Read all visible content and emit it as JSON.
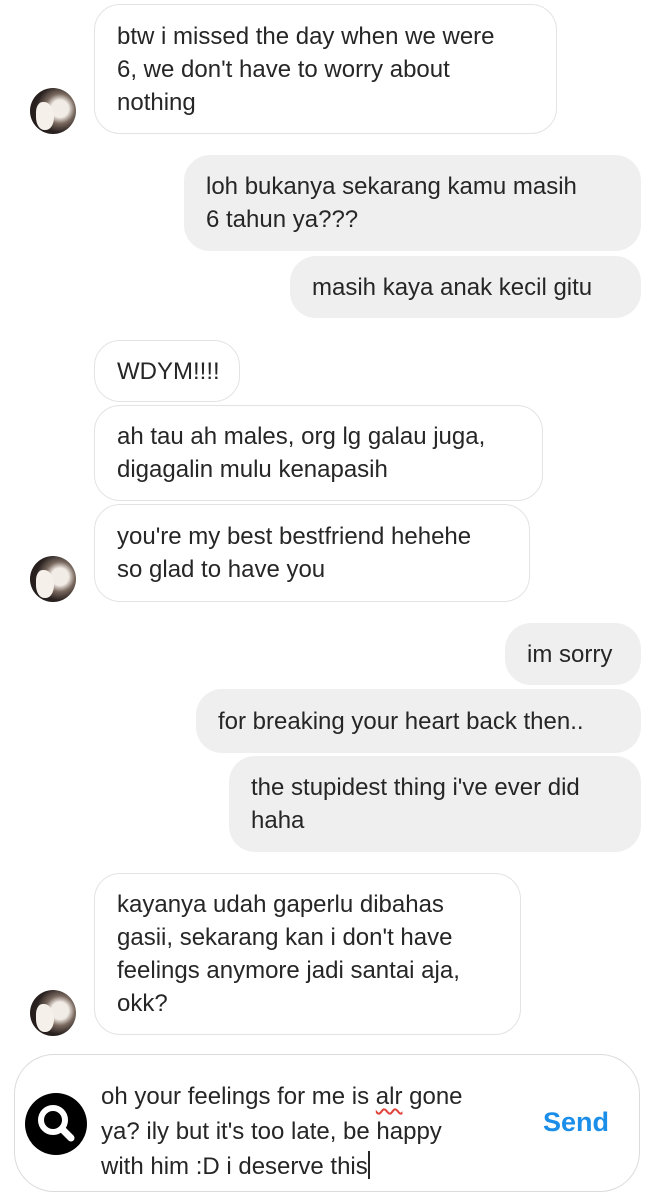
{
  "messages": [
    {
      "side": "in",
      "text": "btw i missed the day when we were\n6, we don't have to worry about\nnothing"
    },
    {
      "side": "out",
      "text": "loh bukanya sekarang kamu masih\n6 tahun ya???"
    },
    {
      "side": "out",
      "text": "masih kaya anak kecil gitu"
    },
    {
      "side": "in",
      "text": "WDYM!!!!"
    },
    {
      "side": "in",
      "text": "ah tau ah males, org lg galau juga,\ndigagalin mulu kenapasih"
    },
    {
      "side": "in",
      "text": "you're my best bestfriend hehehe\nso glad to have you"
    },
    {
      "side": "out",
      "text": "im sorry"
    },
    {
      "side": "out",
      "text": "for breaking your heart back then.."
    },
    {
      "side": "out",
      "text": "the stupidest thing i've ever did\nhaha"
    },
    {
      "side": "in",
      "text": "kayanya udah gaperlu dibahas\ngasii, sekarang kan i don't have\nfeelings anymore jadi santai aja,\nokk?"
    }
  ],
  "composer": {
    "line1_pre": "oh your feelings for me is ",
    "line1_misspelled": "alr",
    "line1_post": " gone",
    "rest": "ya? ily but it's too late, be happy\nwith him :D i deserve this",
    "send_label": "Send",
    "search_icon": "search-icon"
  }
}
